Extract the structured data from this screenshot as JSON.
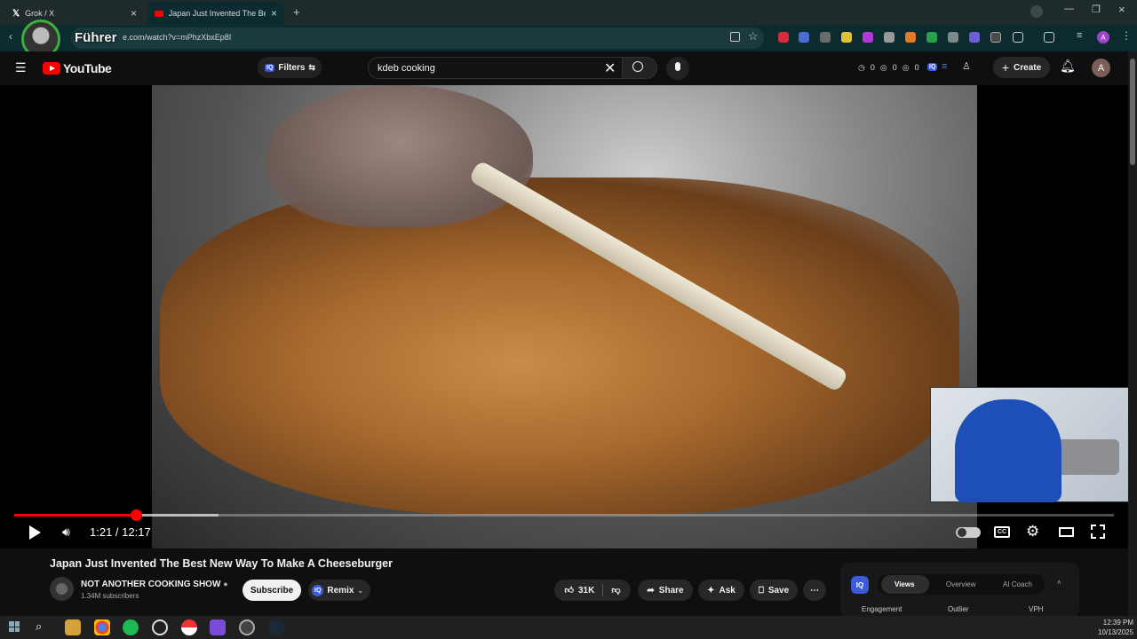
{
  "browser": {
    "tabs": [
      {
        "title": "Grok / X",
        "icon": "x-logo-icon"
      },
      {
        "title": "Japan Just Invented The Best N",
        "icon": "youtube-icon"
      }
    ],
    "new_tab_label": "+",
    "url": "e.com/watch?v=mPhzXbxEp8I",
    "overlay_text": "Führer",
    "profile_initial": "A"
  },
  "youtube": {
    "logo_text": "YouTube",
    "filters_label": "Filters",
    "iq_badge": "IQ",
    "search_value": "kdeb cooking",
    "counters": [
      "0",
      "0",
      "0"
    ],
    "counter_extra": "0",
    "create_label": "Create",
    "profile_initial": "A"
  },
  "player": {
    "current_time": "1:21",
    "duration": "12:17",
    "time_display": "1:21 / 12:17",
    "progress_fraction": 0.111,
    "buffered_fraction": 0.186
  },
  "video": {
    "title": "Japan Just Invented The Best New Way To Make A Cheeseburger",
    "channel_name": "NOT ANOTHER COOKING SHOW",
    "subscribers": "1.34M subscribers",
    "subscribe_label": "Subscribe",
    "remix_label": "Remix",
    "likes": "31K",
    "share_label": "Share",
    "ask_label": "Ask",
    "save_label": "Save"
  },
  "iq_panel": {
    "badge": "IQ",
    "tabs": [
      "Views",
      "Overview",
      "AI Coach"
    ],
    "active_tab": "Views",
    "stats_headers": [
      "Engagement",
      "Outlier",
      "VPH"
    ]
  },
  "taskbar": {
    "time": "12:39 PM",
    "date": "10/13/2025"
  }
}
